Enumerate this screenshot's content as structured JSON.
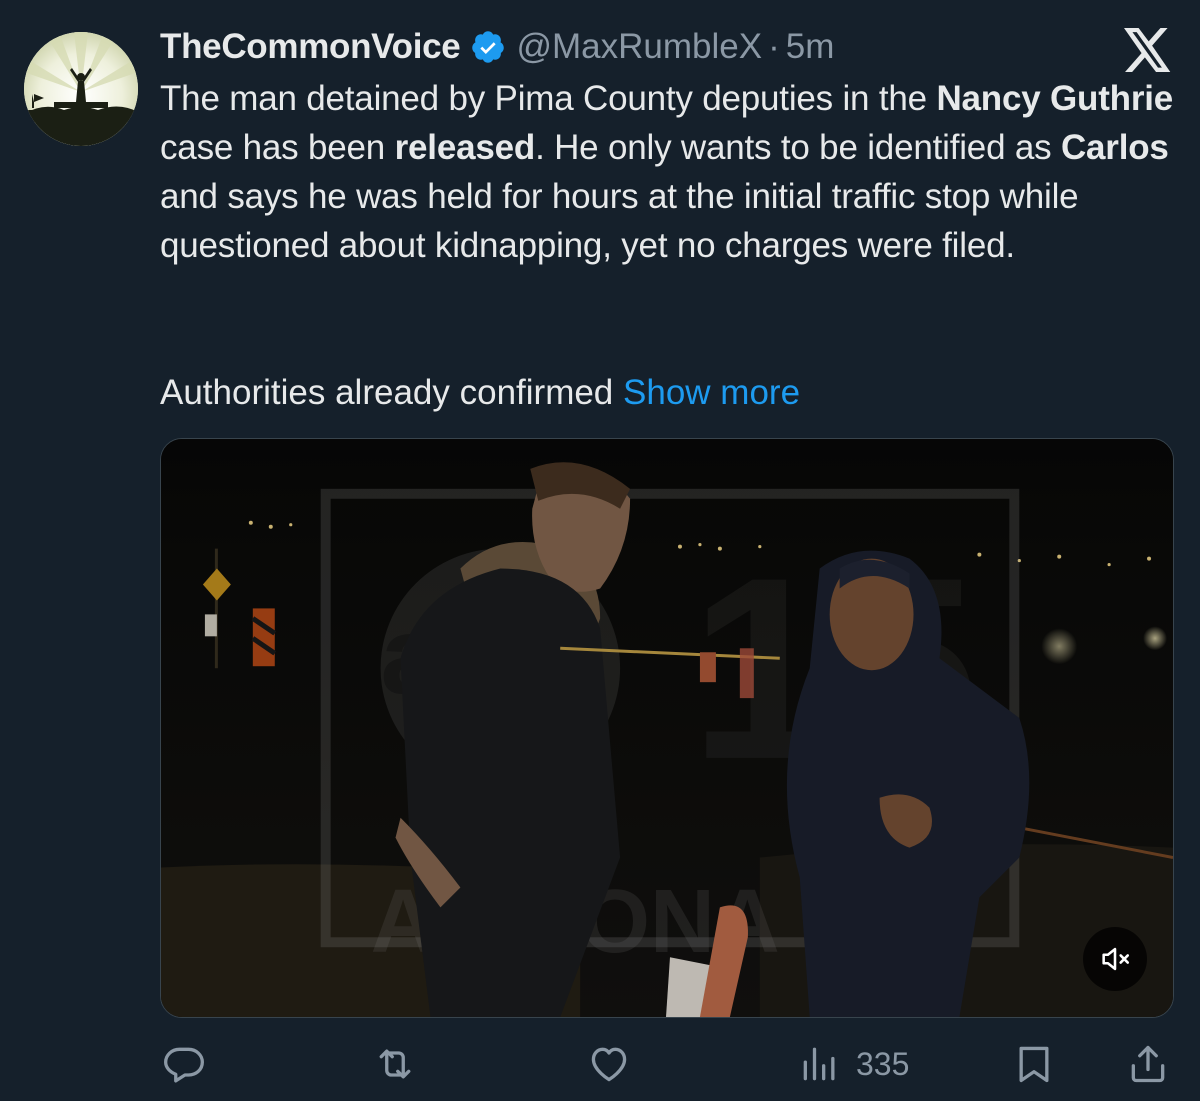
{
  "author": {
    "display_name": "TheCommonVoice",
    "handle": "@MaxRumbleX",
    "separator": "·",
    "time": "5m",
    "verified": true,
    "avatar_icon": "silhouette-sunburst-avatar"
  },
  "platform_logo": "x-logo",
  "post": {
    "segments": [
      {
        "text": "The man detained by Pima County deputies in the ",
        "bold": false
      },
      {
        "text": "Nancy Guthrie",
        "bold": true
      },
      {
        "text": " case has been ",
        "bold": false
      },
      {
        "text": "released",
        "bold": true
      },
      {
        "text": ". He only wants to be identified as ",
        "bold": false
      },
      {
        "text": "Carlos",
        "bold": true
      },
      {
        "text": " and says he was held for hours at the initial traffic stop while questioned about kidnapping, yet no charges were filed.",
        "bold": false
      }
    ],
    "second_paragraph": "Authorities already confirmed",
    "show_more": "Show more"
  },
  "media": {
    "type": "video",
    "description_icon": "news-video-thumbnail",
    "mute_icon": "speaker-muted-icon"
  },
  "actions": {
    "reply_icon": "reply-icon",
    "repost_icon": "repost-icon",
    "like_icon": "heart-icon",
    "views_icon": "views-bar-icon",
    "views_count": "335",
    "bookmark_icon": "bookmark-icon",
    "share_icon": "share-icon"
  },
  "colors": {
    "background": "#15202b",
    "text": "#e7e9ea",
    "muted": "#8b98a5",
    "accent": "#1d9bf0"
  }
}
